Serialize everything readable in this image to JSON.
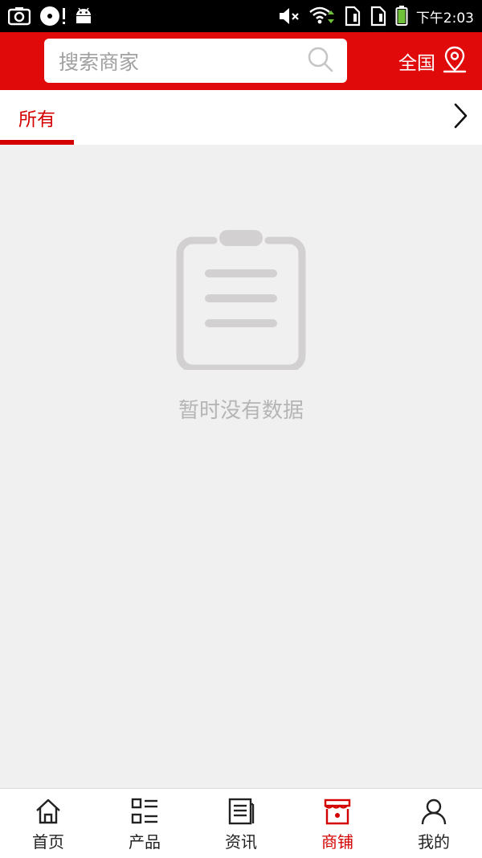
{
  "status_bar": {
    "time": "下午2:03",
    "icons": [
      "screenshot-icon",
      "disc-icon",
      "android-icon",
      "mute-icon",
      "wifi-icon",
      "sim-icon",
      "sim-icon",
      "battery-icon"
    ]
  },
  "header": {
    "search_placeholder": "搜索商家",
    "region_label": "全国"
  },
  "tabs": {
    "items": [
      {
        "label": "所有",
        "active": true
      }
    ]
  },
  "empty_state": {
    "message": "暂时没有数据"
  },
  "bottom_nav": {
    "items": [
      {
        "label": "首页",
        "icon": "home-icon",
        "active": false
      },
      {
        "label": "产品",
        "icon": "product-list-icon",
        "active": false
      },
      {
        "label": "资讯",
        "icon": "news-icon",
        "active": false
      },
      {
        "label": "商铺",
        "icon": "shop-icon",
        "active": true
      },
      {
        "label": "我的",
        "icon": "user-icon",
        "active": false
      }
    ]
  },
  "colors": {
    "brand_red": "#e00a0a",
    "active_red": "#d40000",
    "background": "#f0f0f0",
    "empty_gray": "#d2d0d0"
  }
}
